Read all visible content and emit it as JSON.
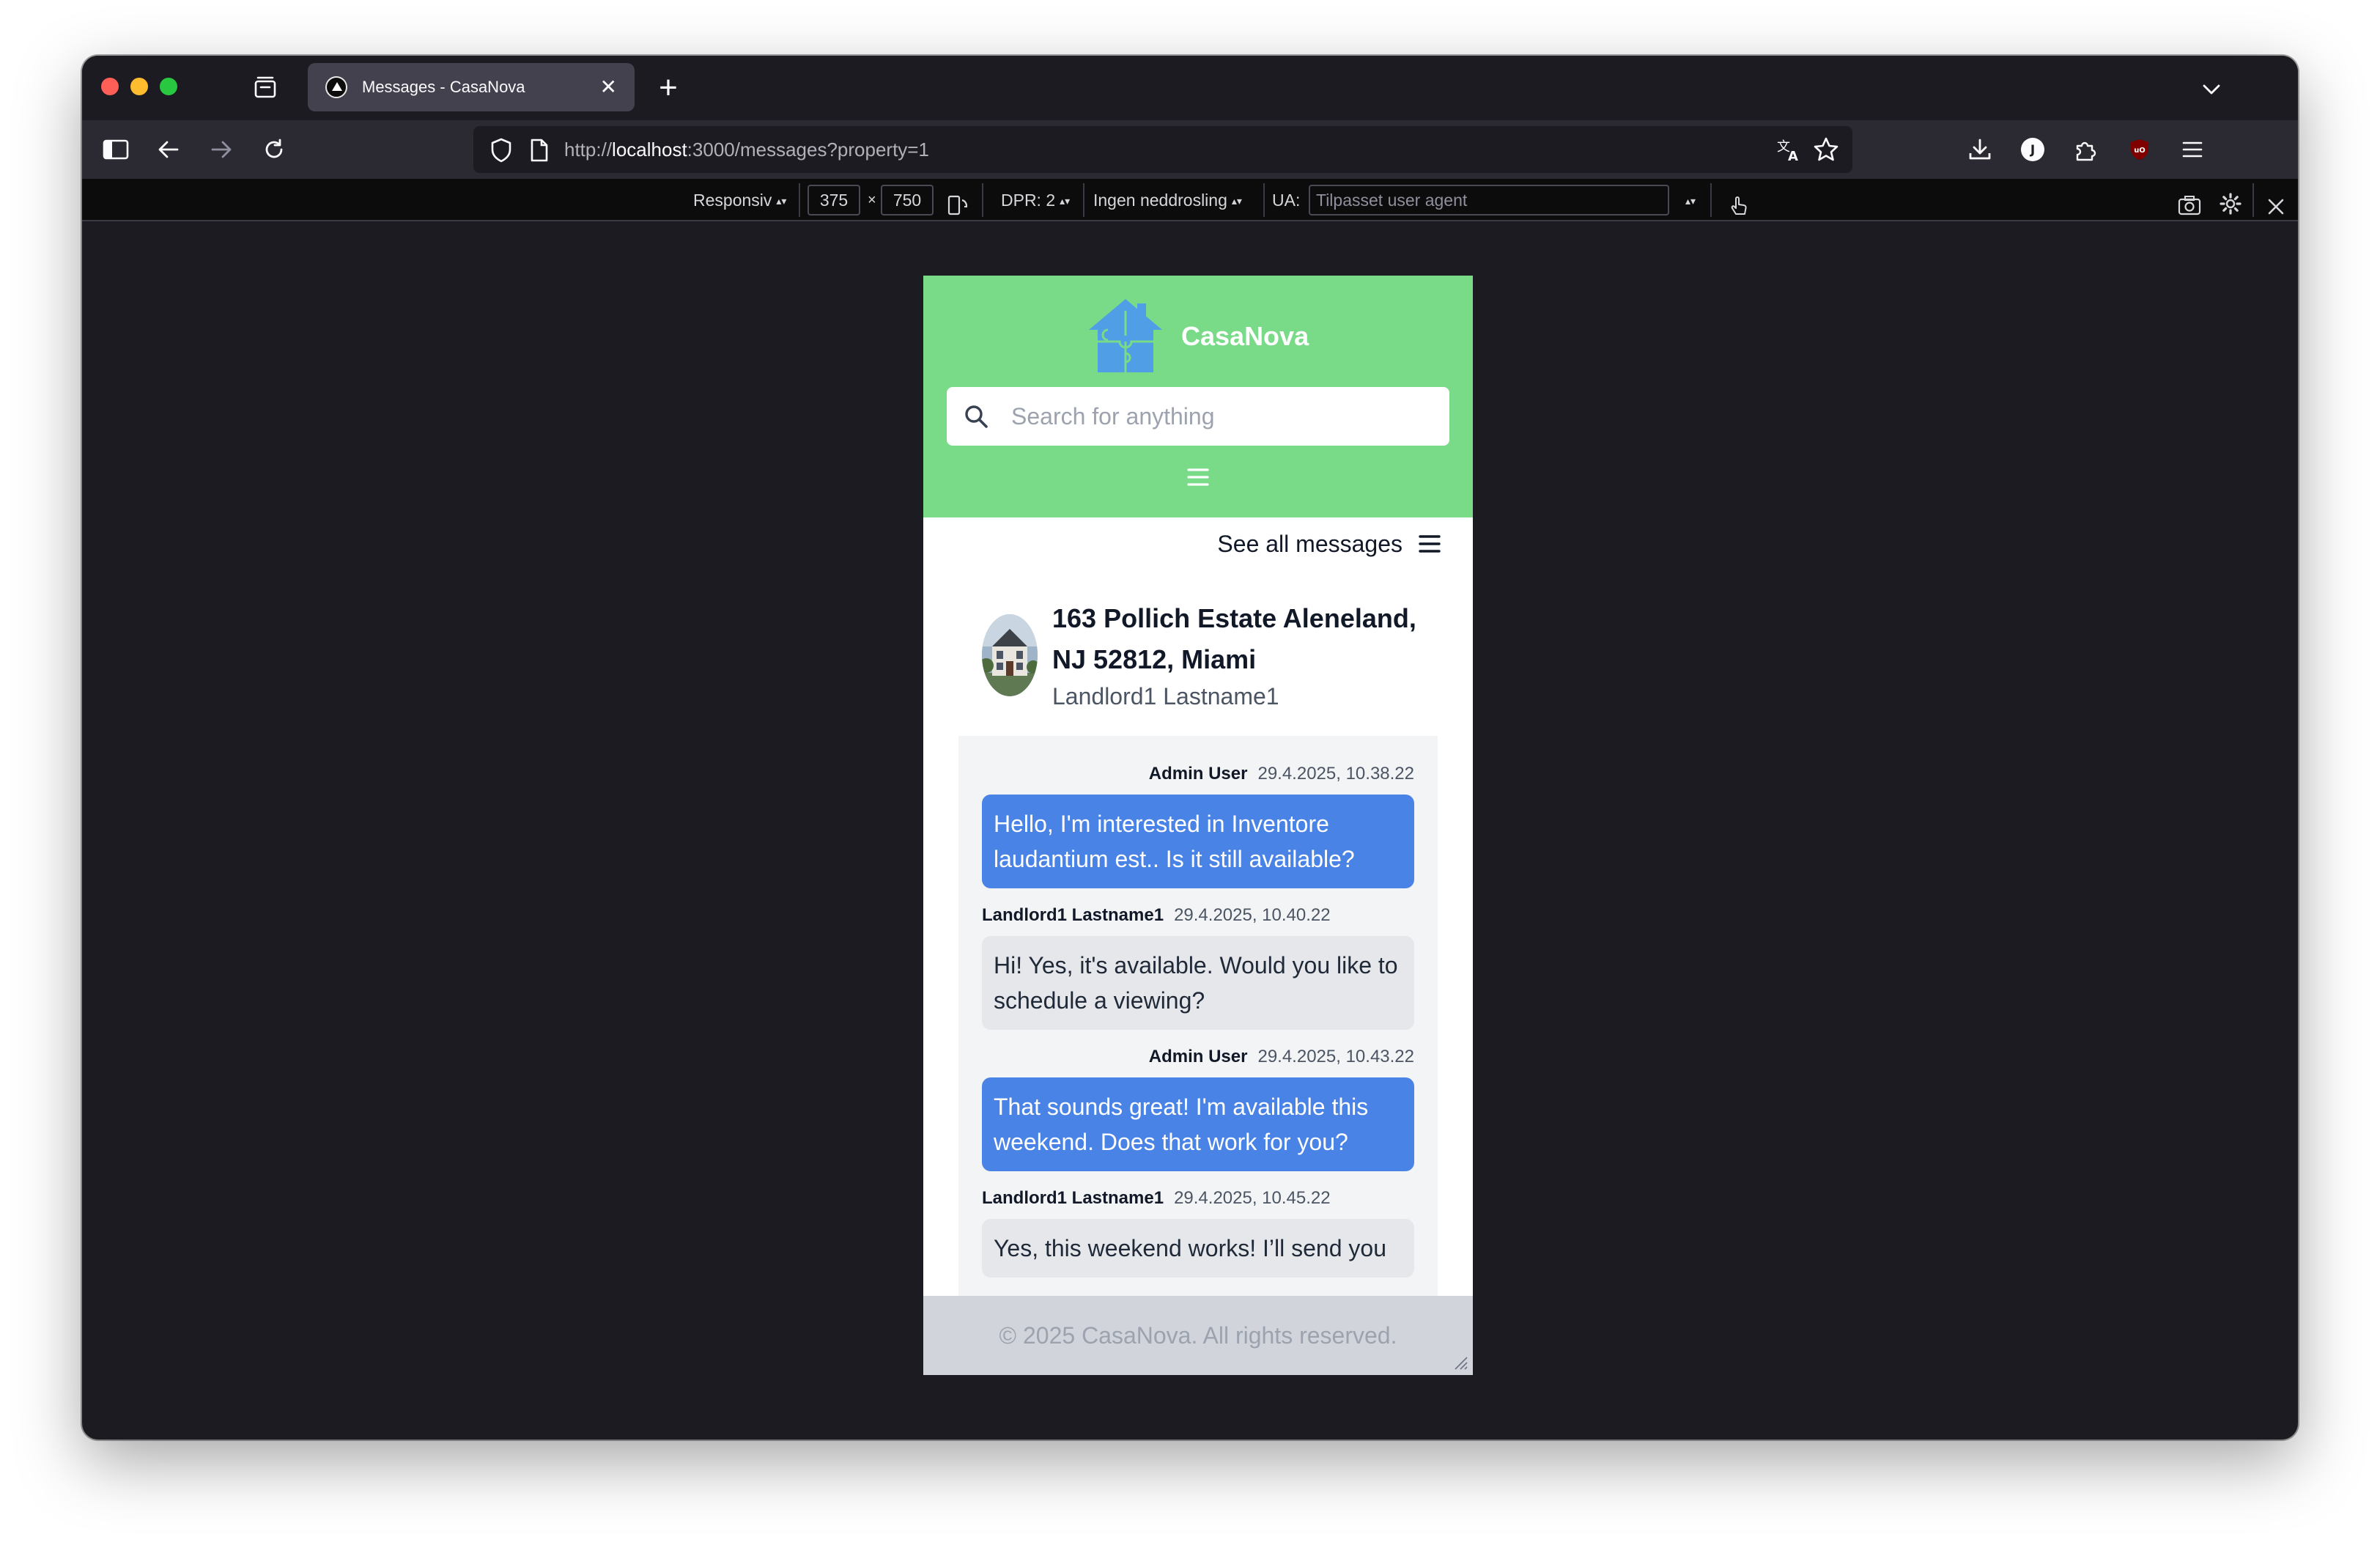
{
  "browser": {
    "tab_title": "Messages - CasaNova",
    "url_prefix": "http://",
    "url_host": "localhost",
    "url_rest": ":3000/messages?property=1"
  },
  "rdm": {
    "device_label": "Responsiv",
    "width": "375",
    "times": "×",
    "height": "750",
    "dpr_label": "DPR: 2",
    "throttling_label": "Ingen neddrosling",
    "ua_label": "UA:",
    "ua_placeholder": "Tilpasset user agent"
  },
  "app": {
    "brand": "CasaNova",
    "search_placeholder": "Search for anything",
    "see_all": "See all messages",
    "property_title": "163 Pollich Estate Aleneland, NJ 52812, Miami",
    "landlord": "Landlord1 Lastname1",
    "messages": [
      {
        "author": "Admin User",
        "time": "29.4.2025, 10.38.22",
        "text": "Hello, I'm interested in Inventore laudantium est.. Is it still available?"
      },
      {
        "author": "Landlord1 Lastname1",
        "time": "29.4.2025, 10.40.22",
        "text": "Hi! Yes, it's available. Would you like to schedule a viewing?"
      },
      {
        "author": "Admin User",
        "time": "29.4.2025, 10.43.22",
        "text": "That sounds great! I'm available this weekend. Does that work for you?"
      },
      {
        "author": "Landlord1 Lastname1",
        "time": "29.4.2025, 10.45.22",
        "text": "Yes, this weekend works! I’ll send you"
      }
    ],
    "footer": "© 2025 CasaNova. All rights reserved."
  },
  "colors": {
    "header_green": "#79da88",
    "my_bubble": "#4a83e6",
    "their_bubble": "#e5e7eb"
  }
}
